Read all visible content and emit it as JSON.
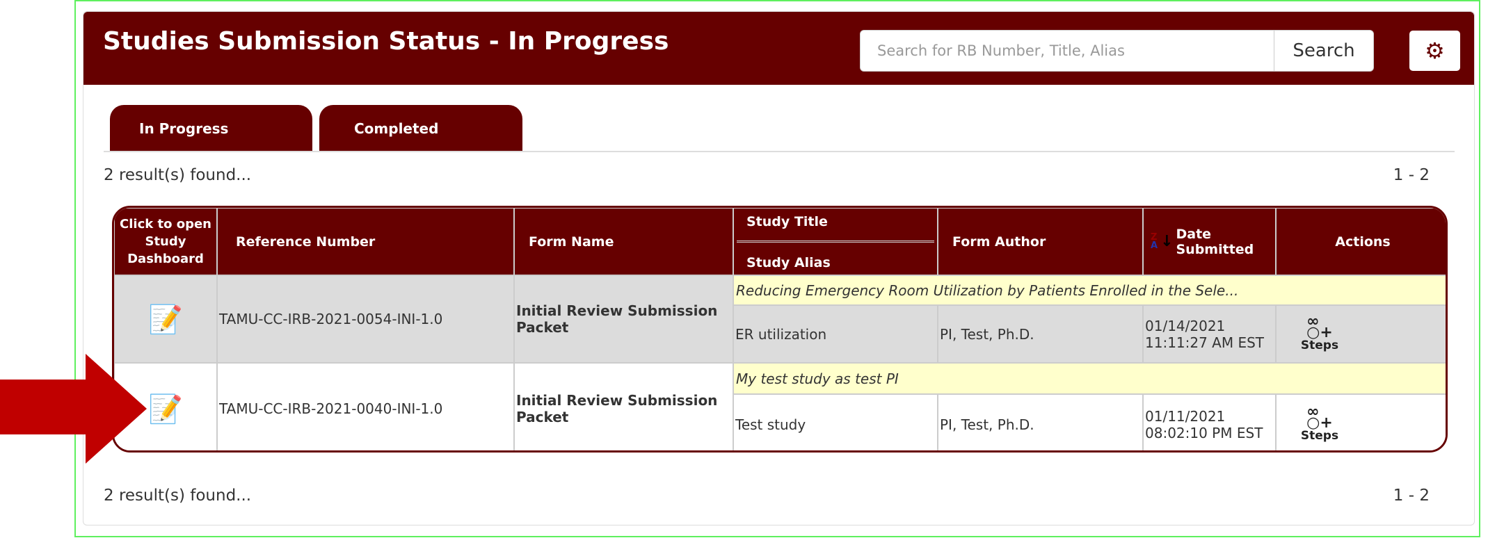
{
  "header": {
    "title": "Studies Submission Status - In Progress",
    "search_placeholder": "Search for RB Number, Title, Alias",
    "search_button": "Search",
    "settings_icon": "gear-icon"
  },
  "tabs": [
    {
      "label": "In Progress",
      "active": true
    },
    {
      "label": "Completed",
      "active": false
    }
  ],
  "results_text": "2 result(s) found...",
  "pagination": "1 - 2",
  "table": {
    "columns": {
      "open": "Click to open Study Dashboard",
      "ref": "Reference Number",
      "form": "Form Name",
      "title": "Study Title",
      "alias": "Study Alias",
      "author": "Form Author",
      "date": "Date Submitted",
      "actions": "Actions"
    },
    "sort_icon": "sort-z-a-descending-icon",
    "rows": [
      {
        "ref": "TAMU-CC-IRB-2021-0054-INI-1.0",
        "form": "Initial Review Submission Packet",
        "title": "Reducing Emergency Room Utilization by Patients Enrolled in the Sele...",
        "alias": "ER utilization",
        "author": "PI, Test, Ph.D.",
        "date": "01/14/2021",
        "time": "11:11:27 AM EST",
        "action": "Steps"
      },
      {
        "ref": "TAMU-CC-IRB-2021-0040-INI-1.0",
        "form": "Initial Review Submission Packet",
        "title": "My test study as test PI",
        "alias": "Test study",
        "author": "PI, Test, Ph.D.",
        "date": "01/11/2021",
        "time": "08:02:10 PM EST",
        "action": "Steps"
      }
    ]
  },
  "colors": {
    "brand": "#660000",
    "title_row": "#ffffcc",
    "alt_row": "#dcdcdc",
    "arrow": "#c00000"
  }
}
